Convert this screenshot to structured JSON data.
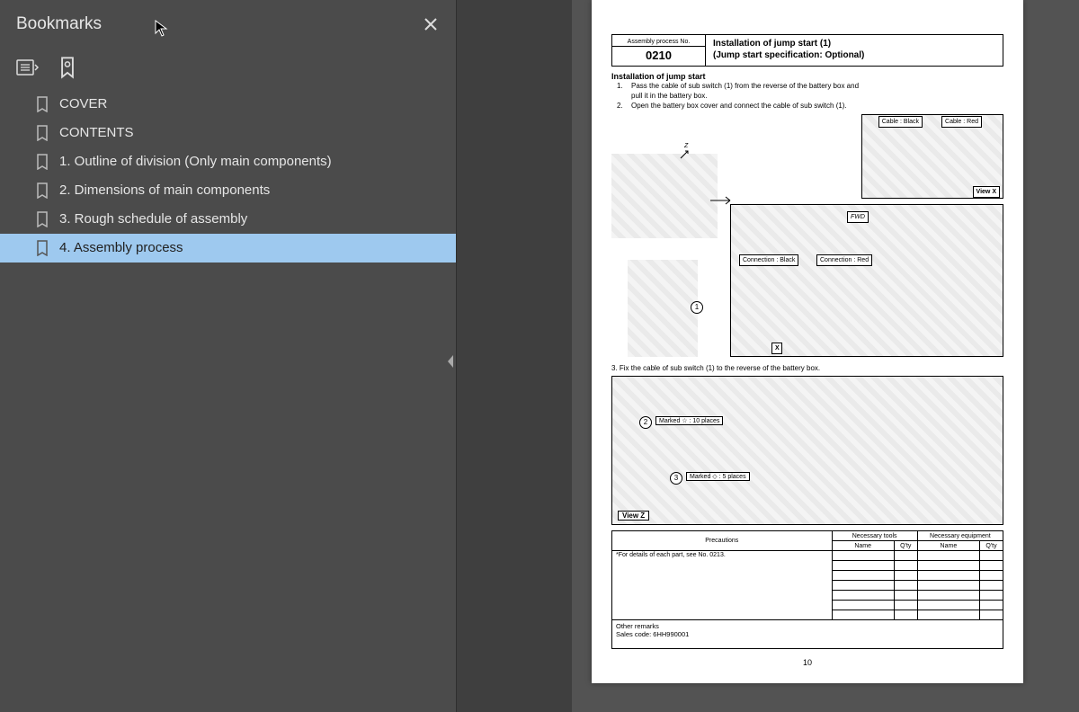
{
  "sidebar": {
    "title": "Bookmarks",
    "bookmarks": [
      {
        "label": "COVER"
      },
      {
        "label": "CONTENTS"
      },
      {
        "label": "1. Outline of division (Only main components)"
      },
      {
        "label": "2. Dimensions of main components"
      },
      {
        "label": "3. Rough schedule of assembly"
      },
      {
        "label": "4. Assembly process"
      }
    ],
    "selected_index": 5
  },
  "doc": {
    "proc_no_label": "Assembly process No.",
    "proc_no": "0210",
    "proc_title_1": "Installation of jump start (1)",
    "proc_title_2": "(Jump start specification: Optional)",
    "section_title": "Installation of jump start",
    "steps": [
      {
        "n": "1.",
        "t": "Pass the cable of sub switch (1) from the reverse of the battery box and pull it in the battery box."
      },
      {
        "n": "2.",
        "t": "Open the battery box cover and connect the cable of sub switch (1)."
      }
    ],
    "cable_black": "Cable : Black",
    "cable_red": "Cable : Red",
    "view_x": "View X",
    "fwd": "FWD",
    "conn_black": "Connection : Black",
    "conn_red": "Connection : Red",
    "x_mark": "X",
    "z_mark": "Z",
    "step3": "3.   Fix the cable of sub switch (1) to the reverse of the battery box.",
    "marked_star": "Marked ☆  : 10 places",
    "marked_diamond": "Marked ◇  : 5 places",
    "view_z": "View Z",
    "precautions_h": "Precautions",
    "precautions_row": "*For details of each part, see No. 0213.",
    "tools_h": "Necessary tools",
    "equip_h": "Necessary equipment",
    "name_h": "Name",
    "qty_h": "Q'ty",
    "remarks_label": "Other remarks",
    "remarks_text": "Sales code: 6HH990001",
    "page_number": "10"
  }
}
